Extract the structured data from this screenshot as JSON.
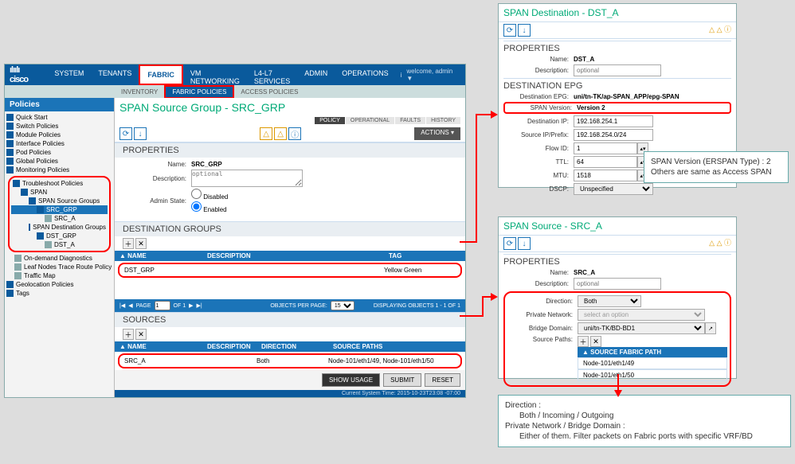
{
  "top": {
    "brand": "cisco",
    "tabs": [
      "SYSTEM",
      "TENANTS",
      "FABRIC",
      "VM NETWORKING",
      "L4-L7 SERVICES",
      "ADMIN",
      "OPERATIONS"
    ],
    "active_tab": "FABRIC",
    "welcome": "welcome, admin ▼",
    "info": "i",
    "sub_tabs": {
      "inventory": "INVENTORY",
      "fabric_policies": "FABRIC POLICIES",
      "access_policies": "ACCESS POLICIES",
      "active": "FABRIC POLICIES"
    }
  },
  "side": {
    "header": "Policies",
    "rows": [
      {
        "lbl": "Quick Start",
        "lvl": 0,
        "icn": "grp"
      },
      {
        "lbl": "Switch Policies",
        "lvl": 0,
        "icn": "grp"
      },
      {
        "lbl": "Module Policies",
        "lvl": 0,
        "icn": "grp"
      },
      {
        "lbl": "Interface Policies",
        "lvl": 0,
        "icn": "grp"
      },
      {
        "lbl": "Pod Policies",
        "lvl": 0,
        "icn": "grp"
      },
      {
        "lbl": "Global Policies",
        "lvl": 0,
        "icn": "grp"
      },
      {
        "lbl": "Monitoring Policies",
        "lvl": 0,
        "icn": "grp"
      }
    ],
    "marked_group": [
      {
        "lbl": "Troubleshoot Policies",
        "lvl": 0,
        "icn": "grp"
      },
      {
        "lbl": "SPAN",
        "lvl": 1,
        "icn": "grp"
      },
      {
        "lbl": "SPAN Source Groups",
        "lvl": 2,
        "icn": "grp"
      },
      {
        "lbl": "SRC_GRP",
        "lvl": 3,
        "icn": "grp",
        "sel": true
      },
      {
        "lbl": "SRC_A",
        "lvl": 4,
        "icn": "leaf"
      },
      {
        "lbl": "SPAN Destination Groups",
        "lvl": 2,
        "icn": "grp"
      },
      {
        "lbl": "DST_GRP",
        "lvl": 3,
        "icn": "grp"
      },
      {
        "lbl": "DST_A",
        "lvl": 4,
        "icn": "leaf"
      }
    ],
    "rows2": [
      {
        "lbl": "On-demand Diagnostics",
        "lvl": 1,
        "icn": "leaf"
      },
      {
        "lbl": "Leaf Nodes Trace Route Policy",
        "lvl": 1,
        "icn": "leaf"
      },
      {
        "lbl": "Traffic Map",
        "lvl": 1,
        "icn": "leaf"
      },
      {
        "lbl": "Geolocation Policies",
        "lvl": 0,
        "icn": "grp"
      },
      {
        "lbl": "Tags",
        "lvl": 0,
        "icn": "grp"
      }
    ]
  },
  "work": {
    "title": "SPAN Source Group - SRC_GRP",
    "tabs": {
      "policy": "POLICY",
      "operational": "OPERATIONAL",
      "faults": "FAULTS",
      "history": "HISTORY"
    },
    "actions": "ACTIONS ▾",
    "sections": {
      "properties": "PROPERTIES",
      "dest": "DESTINATION GROUPS",
      "sources": "SOURCES"
    },
    "props": {
      "name_lbl": "Name:",
      "name_val": "SRC_GRP",
      "desc_lbl": "Description:",
      "desc_ph": "optional",
      "admin_lbl": "Admin State:",
      "disabled": "Disabled",
      "enabled": "Enabled"
    },
    "dest_cols": {
      "name": "▲ NAME",
      "desc": "DESCRIPTION",
      "tag": "TAG"
    },
    "dest_row": {
      "name": "DST_GRP",
      "desc": "",
      "tag": "Yellow Green"
    },
    "pager": {
      "page_lbl": "PAGE",
      "page": "1",
      "of": "OF 1",
      "opp": "OBJECTS PER PAGE:",
      "opp_val": "15",
      "disp": "DISPLAYING OBJECTS 1 - 1 OF 1"
    },
    "src_cols": {
      "name": "▲ NAME",
      "desc": "DESCRIPTION",
      "dir": "DIRECTION",
      "paths": "SOURCE PATHS"
    },
    "src_row": {
      "name": "SRC_A",
      "desc": "",
      "dir": "Both",
      "paths": "Node-101/eth1/49, Node-101/eth1/50"
    },
    "foot": {
      "show": "SHOW USAGE",
      "submit": "SUBMIT",
      "reset": "RESET"
    },
    "status": "Current System Time: 2015-10-23T23:08 -07:00"
  },
  "dest_panel": {
    "title": "SPAN Destination - DST_A",
    "sec_props": "PROPERTIES",
    "sec_epg": "DESTINATION EPG",
    "name_lbl": "Name:",
    "name_val": "DST_A",
    "desc_lbl": "Description:",
    "desc_ph": "optional",
    "epg_lbl": "Destination EPG:",
    "epg_val": "uni/tn-TK/ap-SPAN_APP/epg-SPAN",
    "ver_lbl": "SPAN Version:",
    "ver_val": "Version 2",
    "dip_lbl": "Destination IP:",
    "dip_val": "192.168.254.1",
    "sip_lbl": "Source IP/Prefix:",
    "sip_val": "192.168.254.0/24",
    "flow_lbl": "Flow ID:",
    "flow_val": "1",
    "ttl_lbl": "TTL:",
    "ttl_val": "64",
    "mtu_lbl": "MTU:",
    "mtu_val": "1518",
    "dscp_lbl": "DSCP:",
    "dscp_val": "Unspecified"
  },
  "src_panel": {
    "title": "SPAN Source - SRC_A",
    "sec_props": "PROPERTIES",
    "name_lbl": "Name:",
    "name_val": "SRC_A",
    "desc_lbl": "Description:",
    "desc_ph": "optional",
    "dir_lbl": "Direction:",
    "dir_val": "Both",
    "pn_lbl": "Private Network:",
    "pn_ph": "select an option",
    "bd_lbl": "Bridge Domain:",
    "bd_val": "uni/tn-TK/BD-BD1",
    "paths_lbl": "Source Paths:",
    "paths_hdr": "▲ SOURCE FABRIC PATH",
    "path1": "Node-101/eth1/49",
    "path2": "Node-101/eth1/50"
  },
  "callouts": {
    "top_l1": "SPAN Version (ERSPAN Type) : 2",
    "top_l2": "Others are same as Access SPAN",
    "bot_dir": "Direction :",
    "bot_dir_val": "Both / Incoming / Outgoing",
    "bot_pn": "Private Network / Bridge Domain :",
    "bot_pn_val": "Either of them. Filter packets on Fabric ports with specific VRF/BD"
  }
}
